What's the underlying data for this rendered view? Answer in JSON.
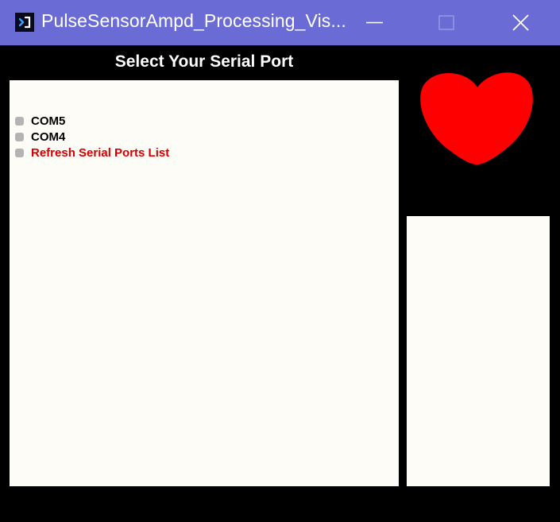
{
  "window": {
    "title": "PulseSensorAmpd_Processing_Vis...",
    "title_bar_color": "#6b6bd6",
    "buttons": {
      "minimize": "minimize-icon",
      "maximize": "maximize-icon",
      "close": "close-icon"
    }
  },
  "main": {
    "title": "Select Your Serial Port",
    "ports": [
      {
        "label": "COM5"
      },
      {
        "label": "COM4"
      }
    ],
    "refresh_label": "Refresh Serial Ports List",
    "refresh_color": "#d40000",
    "panel_color": "#fdfcf7"
  },
  "heart": {
    "icon": "heart-icon",
    "color": "#ff0000"
  }
}
